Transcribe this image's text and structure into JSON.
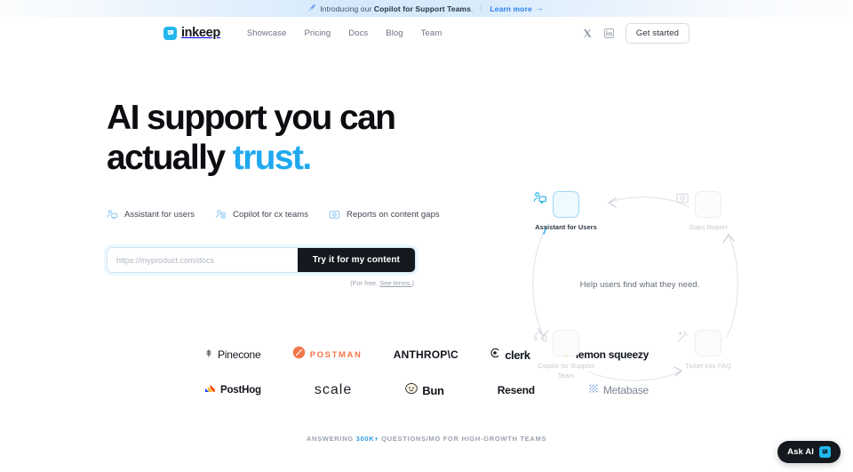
{
  "banner": {
    "icon": "rocket-icon",
    "text_prefix": "Introducing our ",
    "text_bold": "Copilot for Support Teams",
    "text_suffix": ".",
    "link_label": "Learn more",
    "arrow": "→"
  },
  "nav": {
    "brand": "inkeep",
    "links": [
      {
        "label": "Showcase"
      },
      {
        "label": "Pricing"
      },
      {
        "label": "Docs"
      },
      {
        "label": "Blog"
      },
      {
        "label": "Team"
      }
    ],
    "social": [
      {
        "name": "x-twitter-icon"
      },
      {
        "name": "linkedin-icon"
      }
    ],
    "cta_label": "Get started"
  },
  "hero": {
    "headline_line1": "AI support you can",
    "headline_line2_plain": "actually ",
    "headline_line2_accent": "trust.",
    "accent_color": "#1fa9ef",
    "features": [
      {
        "icon": "assistant-icon",
        "label": "Assistant for users"
      },
      {
        "icon": "copilot-icon",
        "label": "Copilot for cx teams"
      },
      {
        "icon": "reports-icon",
        "label": "Reports on content gaps"
      }
    ],
    "form": {
      "placeholder": "https://myproduct.com/docs",
      "value": "",
      "button_label": "Try it for my content",
      "note_prefix": "(For free. ",
      "note_link": "See terms.",
      "note_suffix": ")"
    }
  },
  "diagram": {
    "center_text": "Help users find what they need.",
    "nodes": [
      {
        "id": "assistant",
        "icon": "assistant-users-icon",
        "label": "Assistant for Users",
        "active": true
      },
      {
        "id": "gaps",
        "icon": "gaps-report-icon",
        "label": "Gaps Report",
        "active": false
      },
      {
        "id": "copilot",
        "icon": "headset-icon",
        "label": "Copilot for Support Team",
        "active": false
      },
      {
        "id": "ticket",
        "icon": "magic-wand-icon",
        "label": "Ticket into FAQ",
        "active": false
      }
    ]
  },
  "logos": {
    "row1": [
      {
        "name": "Pinecone",
        "icon": "pinecone-icon"
      },
      {
        "name": "POSTMAN",
        "icon": "postman-icon"
      },
      {
        "name": "ANTHROP\\C",
        "icon": ""
      },
      {
        "name": "clerk",
        "icon": "clerk-icon"
      },
      {
        "name": "lemon squeezy",
        "icon": "lemon-icon"
      }
    ],
    "row2": [
      {
        "name": "PostHog",
        "icon": "posthog-icon"
      },
      {
        "name": "scale",
        "icon": ""
      },
      {
        "name": "Bun",
        "icon": "bun-icon"
      },
      {
        "name": "Resend",
        "icon": ""
      },
      {
        "name": "Metabase",
        "icon": "metabase-icon"
      }
    ]
  },
  "footnote": {
    "prefix": "ANSWERING ",
    "highlight": "300K+",
    "suffix": " QUESTIONS/MO FOR HIGH-GROWTH TEAMS"
  },
  "ask_ai": {
    "label": "Ask AI"
  }
}
